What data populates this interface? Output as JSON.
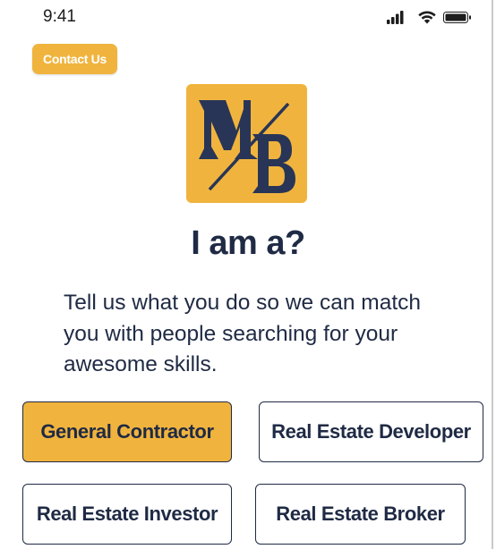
{
  "status_bar": {
    "time": "9:41",
    "icons": [
      "signal-icon",
      "wifi-icon",
      "battery-icon"
    ]
  },
  "header": {
    "contact_label": "Contact Us"
  },
  "logo": {
    "icon": "mb-logo",
    "colors": {
      "background": "#f0b43e",
      "letters": "#283557"
    }
  },
  "main": {
    "title": "I am a?",
    "subtitle": "Tell us what you do so we can match you with people searching for your awesome skills."
  },
  "roles": [
    {
      "label": "General Contractor",
      "selected": true
    },
    {
      "label": "Real Estate Developer",
      "selected": false
    },
    {
      "label": "Real Estate Investor",
      "selected": false
    },
    {
      "label": "Real Estate Broker",
      "selected": false
    }
  ],
  "colors": {
    "accent": "#f0b43e",
    "text": "#1f2a44",
    "border": "#1f2a44"
  }
}
